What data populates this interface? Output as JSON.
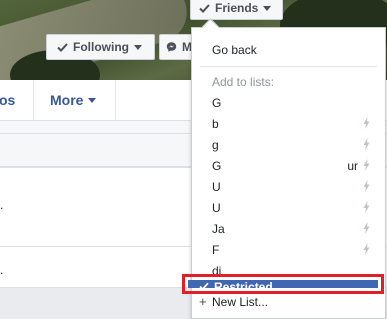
{
  "cover": {
    "friends_label": "Friends",
    "following_label": "Following",
    "message_label": "M"
  },
  "nav": {
    "photos_partial": "os",
    "more_label": "More"
  },
  "dropdown": {
    "go_back": "Go back",
    "header": "Add to lists:",
    "lists": [
      {
        "label": "G",
        "smart": false
      },
      {
        "label": "b",
        "smart": true
      },
      {
        "label": "g",
        "smart": true
      },
      {
        "label": "G",
        "trailing": "ur",
        "smart": true
      },
      {
        "label": "U",
        "smart": true
      },
      {
        "label": "U",
        "smart": true
      },
      {
        "label": "Ja",
        "smart": true
      },
      {
        "label": "F",
        "smart": true
      },
      {
        "label": "di",
        "smart": false
      }
    ],
    "restricted": "Restricted",
    "new_list": "New List..."
  },
  "colors": {
    "accent": "#4267b2",
    "highlight_border": "#e41e26",
    "link": "#365899"
  }
}
